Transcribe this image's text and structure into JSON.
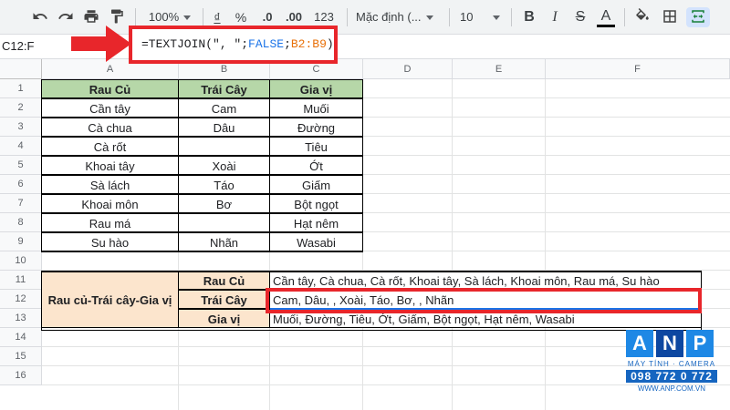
{
  "toolbar": {
    "zoom": "100%",
    "currency": "₫",
    "percent": "%",
    "dec_decrease": ".0",
    "dec_increase": ".00",
    "more_formats": "123",
    "font_name": "Mặc định (...",
    "font_size": "10",
    "bold": "B",
    "italic": "I",
    "strikethrough": "S",
    "text_color": "A"
  },
  "formula_bar": {
    "name_box": "C12:F",
    "formula": {
      "eq": "=TEXTJOIN(",
      "delim": "\", \"",
      "sep1": ";",
      "bool": "FALSE",
      "sep2": ";",
      "ref": "B2:B9",
      "close": ")"
    }
  },
  "columns": [
    "A",
    "B",
    "C",
    "D",
    "E",
    "F"
  ],
  "rows": [
    "1",
    "2",
    "3",
    "4",
    "5",
    "6",
    "7",
    "8",
    "9",
    "10",
    "11",
    "12",
    "13",
    "14",
    "15",
    "16"
  ],
  "table": {
    "headers": [
      "Rau Củ",
      "Trái Cây",
      "Gia vị"
    ],
    "data": [
      [
        "Cần tây",
        "Cam",
        "Muối"
      ],
      [
        "Cà chua",
        "Dâu",
        "Đường"
      ],
      [
        "Cà rốt",
        "",
        "Tiêu"
      ],
      [
        "Khoai tây",
        "Xoài",
        "Ớt"
      ],
      [
        "Sà lách",
        "Táo",
        "Giấm"
      ],
      [
        "Khoai môn",
        "Bơ",
        "Bột ngọt"
      ],
      [
        "Rau má",
        "",
        "Hạt nêm"
      ],
      [
        "Su hào",
        "Nhãn",
        "Wasabi"
      ]
    ]
  },
  "summary": {
    "label": "Rau củ-Trái cây-Gia vị",
    "rows": [
      {
        "name": "Rau Củ",
        "value": "Cần tây, Cà chua, Cà rốt, Khoai tây, Sà lách, Khoai môn, Rau má, Su hào"
      },
      {
        "name": "Trái Cây",
        "value": "Cam, Dâu, , Xoài, Táo, Bơ, , Nhãn"
      },
      {
        "name": "Gia vị",
        "value": "Muối, Đường, Tiêu, Ớt, Giấm, Bột ngọt, Hạt nêm, Wasabi"
      }
    ]
  },
  "colors": {
    "header_green": "#b6d7a8",
    "summary_orange": "#fce5cd",
    "highlight_red": "#e8262b"
  },
  "logo": {
    "letters": [
      "A",
      "N",
      "P"
    ],
    "tagline": "MÁY TÍNH · CAMERA",
    "phone": "098 772 0 772",
    "website": "WWW.ANP.COM.VN"
  }
}
